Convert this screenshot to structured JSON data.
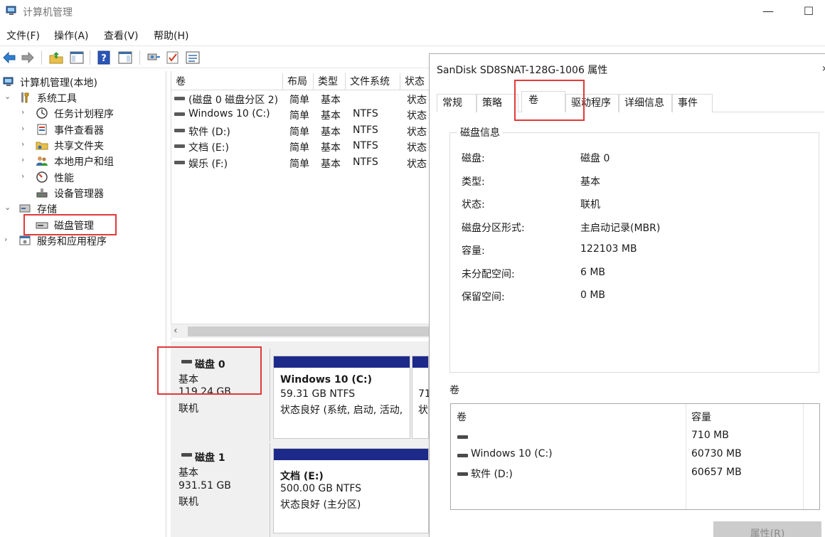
{
  "window": {
    "title": "计算机管理",
    "minimize_glyph": "—",
    "maximize_glyph": "☐"
  },
  "menu": [
    "文件(F)",
    "操作(A)",
    "查看(V)",
    "帮助(H)"
  ],
  "toolbar": {
    "icons": [
      "back-icon",
      "forward-icon",
      "up-folder-icon",
      "show-hide-console-tree-icon",
      "help-icon",
      "show-hide-action-pane-icon",
      "connect-icon",
      "check-icon",
      "list-icon"
    ]
  },
  "tree": {
    "root": "计算机管理(本地)",
    "system_tools": "系统工具",
    "task_scheduler": "任务计划程序",
    "event_viewer": "事件查看器",
    "shared_folders": "共享文件夹",
    "local_users": "本地用户和组",
    "performance": "性能",
    "device_manager": "设备管理器",
    "storage": "存储",
    "disk_management": "磁盘管理",
    "services_apps": "服务和应用程序",
    "chevron_down": "⌄",
    "chevron_right": "›"
  },
  "volume_list": {
    "headers": [
      "卷",
      "布局",
      "类型",
      "文件系统",
      "状态"
    ],
    "rows": [
      {
        "name": "(磁盘 0 磁盘分区 2)",
        "layout": "简单",
        "type": "基本",
        "fs": "",
        "status": "状态"
      },
      {
        "name": "Windows 10 (C:)",
        "layout": "简单",
        "type": "基本",
        "fs": "NTFS",
        "status": "状态"
      },
      {
        "name": "软件 (D:)",
        "layout": "简单",
        "type": "基本",
        "fs": "NTFS",
        "status": "状态"
      },
      {
        "name": "文档 (E:)",
        "layout": "简单",
        "type": "基本",
        "fs": "NTFS",
        "status": "状态"
      },
      {
        "name": "娱乐 (F:)",
        "layout": "简单",
        "type": "基本",
        "fs": "NTFS",
        "status": "状态"
      }
    ],
    "scroll_left": "‹"
  },
  "disks": [
    {
      "name": "磁盘 0",
      "type": "基本",
      "size": "119.24 GB",
      "state": "联机",
      "partitions": [
        {
          "title": "Windows 10  (C:)",
          "line1": "59.31 GB NTFS",
          "line2": "状态良好 (系统, 启动, 活动,"
        },
        {
          "title": "",
          "line1": "71",
          "line2": "状"
        }
      ]
    },
    {
      "name": "磁盘 1",
      "type": "基本",
      "size": "931.51 GB",
      "state": "联机",
      "partitions": [
        {
          "title": "文档  (E:)",
          "line1": "500.00 GB NTFS",
          "line2": "状态良好 (主分区)"
        }
      ]
    }
  ],
  "dialog": {
    "title": "SanDisk SD8SNAT-128G-1006 属性",
    "close_glyph": "›",
    "tabs": [
      "常规",
      "策略",
      "卷",
      "驱动程序",
      "详细信息",
      "事件"
    ],
    "active_tab": "卷",
    "disk_info_title": "磁盘信息",
    "disk_info": [
      {
        "key": "磁盘:",
        "value": "磁盘 0"
      },
      {
        "key": "类型:",
        "value": "基本"
      },
      {
        "key": "状态:",
        "value": "联机"
      },
      {
        "key": "磁盘分区形式:",
        "value": "主启动记录(MBR)"
      },
      {
        "key": "容量:",
        "value": "122103 MB"
      },
      {
        "key": "未分配空间:",
        "value": "6 MB"
      },
      {
        "key": "保留空间:",
        "value": "0 MB"
      }
    ],
    "volumes_title": "卷",
    "volumes_headers": [
      "卷",
      "容量"
    ],
    "volumes": [
      {
        "name": "",
        "capacity": "710 MB"
      },
      {
        "name": "Windows 10 (C:)",
        "capacity": "60730 MB"
      },
      {
        "name": "软件 (D:)",
        "capacity": "60657 MB"
      }
    ],
    "properties_button": "属性(R)"
  }
}
